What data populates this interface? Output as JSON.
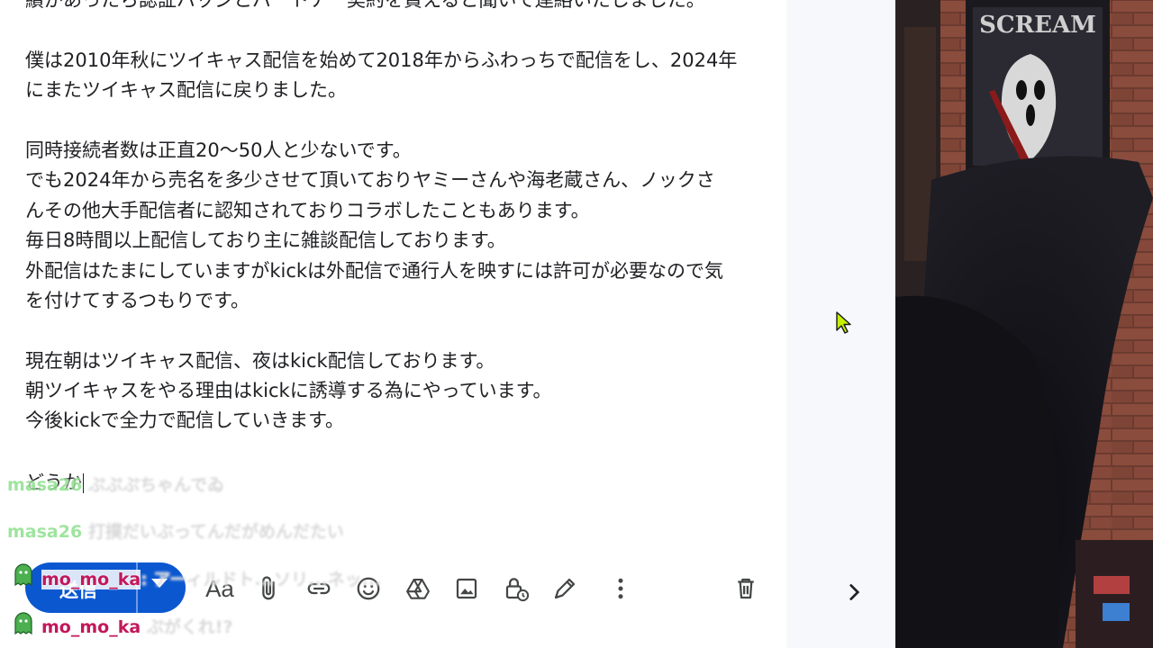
{
  "email_body": {
    "lines": [
      "績があったら認証バッジとパートナー契約を貰えると聞いて連絡いたしました。",
      "",
      "僕は2010年秋にツイキャス配信を始めて2018年からふわっちで配信をし、2024年",
      "にまたツイキャス配信に戻りました。",
      "",
      "同時接続者数は正直20〜50人と少ないです。",
      "でも2024年から売名を多少させて頂いておりヤミーさんや海老蔵さん、ノックさ",
      "んその他大手配信者に認知されておりコラボしたこともあります。",
      "毎日8時間以上配信しており主に雑談配信しております。",
      "外配信はたまにしていますがkickは外配信で通行人を映すには許可が必要なので気",
      "を付けてするつもりです。",
      "",
      "現在朝はツイキャス配信、夜はkick配信しております。",
      "朝ツイキャスをやる理由はkickに誘導する為にやっています。",
      "今後kickで全力で配信していきます。"
    ],
    "typing_line": "どうか"
  },
  "toolbar": {
    "send_label": "送信",
    "icons": [
      "format-text-icon",
      "attach-icon",
      "link-icon",
      "emoji-icon",
      "drive-icon",
      "photo-icon",
      "confidential-icon",
      "signature-icon",
      "more-options-icon",
      "trash-icon"
    ]
  },
  "chat_overlay": [
    {
      "name": "masa26",
      "message": "ぷぷぷちゃんでゐ"
    },
    {
      "name": "masa26",
      "message": "打撲だいぶってんだがめんだたい"
    },
    {
      "name": "mo_mo_ka",
      "message": ": アーィルドト...ソリ...ネッ..."
    },
    {
      "name": "mo_mo_ka",
      "message": "ぷがくれ!?"
    }
  ],
  "webcam": {
    "poster_text": "SCREAM"
  },
  "colors": {
    "send_button": "#0b57d0",
    "chat_name": "#8ee08e",
    "chat_name_highlight": "#c2185b",
    "gutter": "#f6f8fc"
  }
}
